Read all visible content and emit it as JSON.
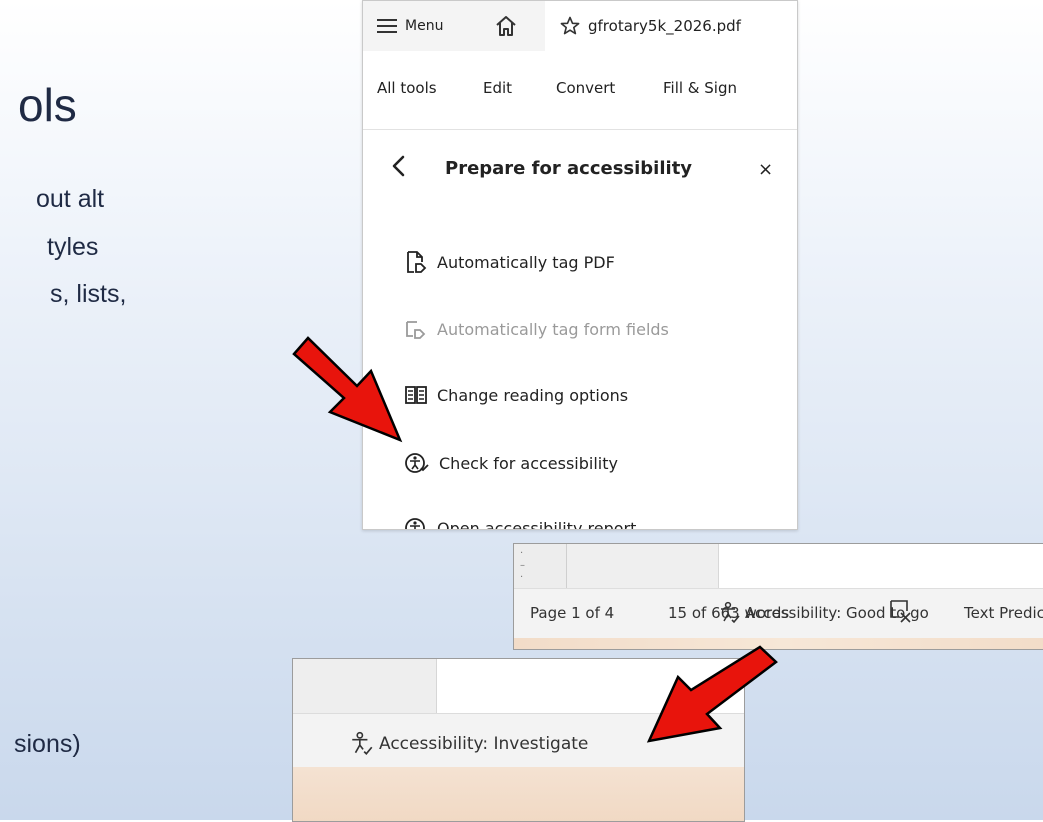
{
  "slide": {
    "heading": "ols",
    "lines": [
      "out alt",
      "tyles",
      "s, lists,",
      "sions)"
    ]
  },
  "acrobat": {
    "menu_label": "Menu",
    "file_name": "gfrotary5k_2026.pdf",
    "toolbar": [
      "All tools",
      "Edit",
      "Convert",
      "Fill & Sign"
    ],
    "panel_title": "Prepare for accessibility",
    "close_symbol": "×",
    "options": [
      {
        "label": "Automatically tag PDF",
        "icon": "tag-pdf-icon",
        "enabled": true
      },
      {
        "label": "Automatically tag form fields",
        "icon": "tag-form-icon",
        "enabled": false
      },
      {
        "label": "Change reading options",
        "icon": "reading-options-icon",
        "enabled": true
      },
      {
        "label": "Check for accessibility",
        "icon": "accessibility-check-icon",
        "enabled": true
      },
      {
        "label": "Open accessibility report",
        "icon": "accessibility-report-icon",
        "enabled": true
      }
    ]
  },
  "word_status": {
    "page": "Page 1 of 4",
    "words": "15 of 663 words",
    "predictions": "Text Predictions: On",
    "accessibility": "Accessibility: Good to go"
  },
  "word_small": {
    "accessibility": "Accessibility: Investigate"
  },
  "colors": {
    "arrow_red": "#e8140c",
    "arrow_outline": "#000000"
  }
}
